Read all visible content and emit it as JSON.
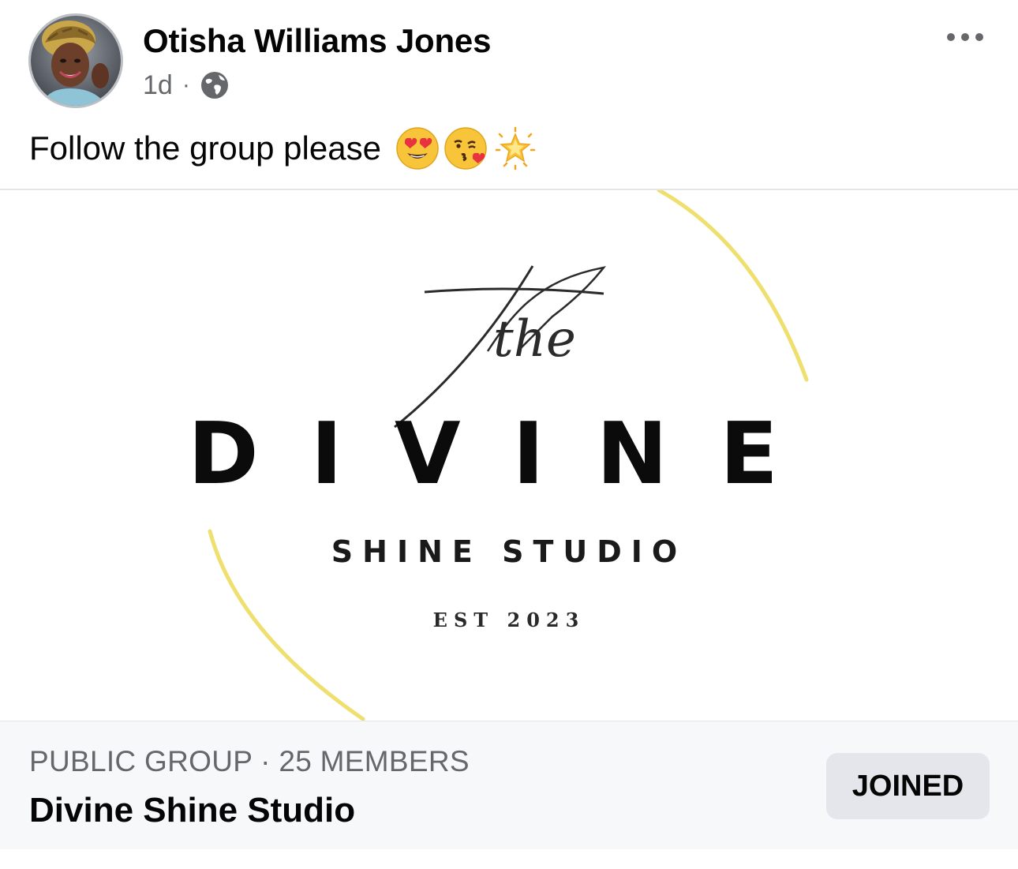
{
  "post": {
    "author_name": "Otisha Williams Jones",
    "timestamp": "1d",
    "separator": "·",
    "audience_icon": "globe-icon",
    "menu_icon": "more-horizontal-icon",
    "text": "Follow the group please",
    "emojis": [
      "heart-eyes-emoji",
      "kissing-heart-emoji",
      "glowing-star-emoji"
    ]
  },
  "group_card": {
    "image": {
      "script_word": "the",
      "main_word": "DIVINE",
      "sub_word": "SHINE STUDIO",
      "established": "EST 2023",
      "ring_color": "#eedf6e"
    },
    "meta": "PUBLIC GROUP · 25 MEMBERS",
    "name": "Divine Shine Studio",
    "joined_label": "JOINED"
  }
}
